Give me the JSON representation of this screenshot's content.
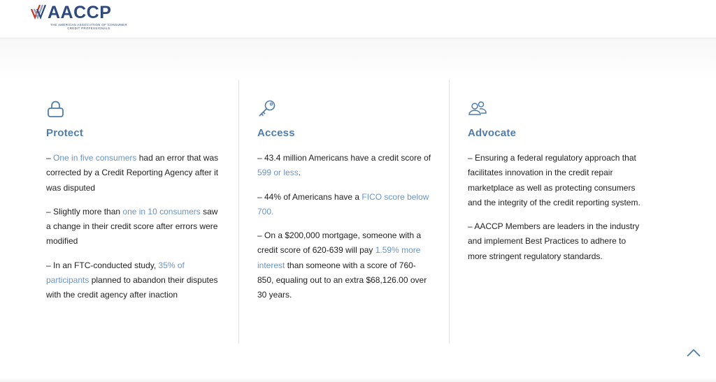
{
  "header": {
    "logo_text": "AACCP",
    "logo_subtitle": "The American Association of Consumer Credit Professionals"
  },
  "columns": [
    {
      "icon": "lock-icon",
      "title": "Protect",
      "paragraphs": [
        [
          {
            "t": "– ",
            "h": false
          },
          {
            "t": "One in five consumers",
            "h": true
          },
          {
            "t": " had an error that was corrected by a Credit Reporting Agency after it was disputed",
            "h": false
          }
        ],
        [
          {
            "t": "– Slightly more than ",
            "h": false
          },
          {
            "t": "one in 10 consumers",
            "h": true
          },
          {
            "t": " saw a change in their credit score after errors were modified",
            "h": false
          }
        ],
        [
          {
            "t": "– In an FTC-conducted study, ",
            "h": false
          },
          {
            "t": "35% of participants",
            "h": true
          },
          {
            "t": " planned to abandon their disputes with the credit agency after inaction",
            "h": false
          }
        ]
      ]
    },
    {
      "icon": "key-icon",
      "title": "Access",
      "paragraphs": [
        [
          {
            "t": "– 43.4 million Americans have a credit score of ",
            "h": false
          },
          {
            "t": "599 or less",
            "h": true
          },
          {
            "t": ".",
            "h": false
          }
        ],
        [
          {
            "t": "– 44% of Americans have a ",
            "h": false
          },
          {
            "t": "FICO score below 700.",
            "h": true
          }
        ],
        [
          {
            "t": "– On a $200,000 mortgage, someone with a credit score of 620-639 will pay ",
            "h": false
          },
          {
            "t": "1.59% more interest",
            "h": true
          },
          {
            "t": " than someone with a score of 760-850, equaling out to an extra $68,126.00 over 30 years.",
            "h": false
          }
        ]
      ]
    },
    {
      "icon": "users-icon",
      "title": "Advocate",
      "paragraphs": [
        [
          {
            "t": "– Ensuring a federal regulatory approach that facilitates innovation in the credit repair marketplace as well as protecting consumers and the integrity of the credit reporting system.",
            "h": false
          }
        ],
        [
          {
            "t": "– AACCP Members are leaders in the industry and implement Best Practices to adhere to more stringent regulatory standards.",
            "h": false
          }
        ]
      ]
    }
  ],
  "scroll_top": {
    "icon": "chevron-up-icon"
  },
  "colors": {
    "accent": "#4f7cac",
    "link": "#6a94c4",
    "brand": "#2e4a7d",
    "brand_red": "#c0392b"
  }
}
